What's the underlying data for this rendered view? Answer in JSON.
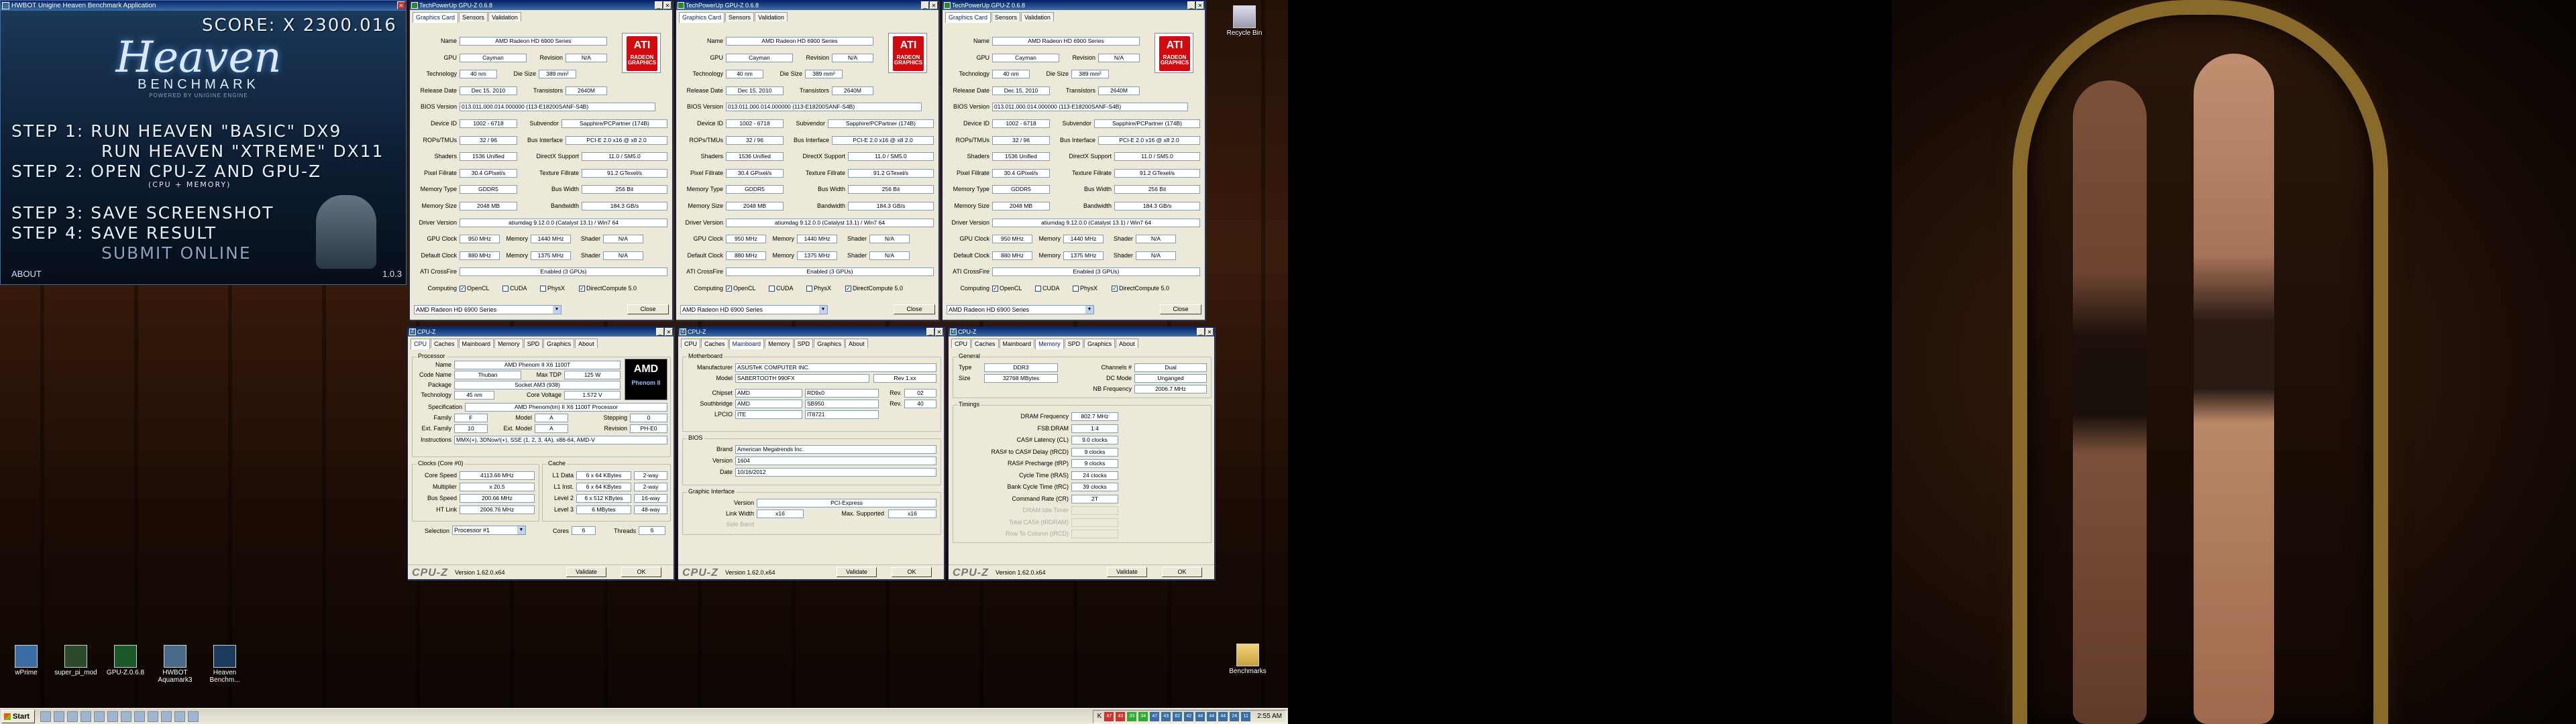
{
  "heaven": {
    "window_title": "HWBOT Unigine Heaven Benchmark Application",
    "score": "SCORE: X 2300.016",
    "logo": "Heaven",
    "logo_sub": "BENCHMARK",
    "logo_powered": "POWERED BY UNIGINE ENGINE",
    "steps": [
      "STEP 1:  RUN HEAVEN \"BASIC\" DX9",
      "RUN HEAVEN \"XTREME\" DX11",
      "STEP 2: OPEN CPU-Z    AND    GPU-Z",
      "(CPU + MEMORY)",
      "STEP 3: SAVE SCREENSHOT",
      "STEP 4: SAVE RESULT",
      "SUBMIT ONLINE"
    ],
    "footer_left": "ABOUT",
    "footer_right": "1.0.3"
  },
  "gpuz": {
    "window_title": "TechPowerUp GPU-Z 0.6.8",
    "tabs": [
      "Graphics Card",
      "Sensors",
      "Validation"
    ],
    "labels": {
      "name": "Name",
      "gpu": "GPU",
      "revision": "Revision",
      "technology": "Technology",
      "die_size": "Die Size",
      "release_date": "Release Date",
      "transistors": "Transistors",
      "bios": "BIOS Version",
      "device_id": "Device ID",
      "subvendor": "Subvendor",
      "rops": "ROPs/TMUs",
      "bus_interface": "Bus Interface",
      "shaders": "Shaders",
      "directx": "DirectX Support",
      "pixel_fillrate": "Pixel Fillrate",
      "texture_fillrate": "Texture Fillrate",
      "memory_type": "Memory Type",
      "bus_width": "Bus Width",
      "memory_size": "Memory Size",
      "bandwidth": "Bandwidth",
      "driver": "Driver Version",
      "gpu_clock": "GPU Clock",
      "memory": "Memory",
      "shader": "Shader",
      "default_clock": "Default Clock",
      "crossfire": "ATI CrossFire",
      "computing": "Computing"
    },
    "values": {
      "name": "AMD Radeon HD 6900 Series",
      "gpu": "Cayman",
      "revision": "N/A",
      "technology": "40 nm",
      "die_size": "389 mm²",
      "release_date": "Dec 15, 2010",
      "transistors": "2640M",
      "bios": "013.011.000.014.000000 (113-E18200SANF-S4B)",
      "device_id": "1002 - 6718",
      "subvendor": "Sapphire/PCPartner (174B)",
      "rops": "32 / 96",
      "bus_interface": "PCI-E 2.0 x16 @ x8 2.0",
      "shaders": "1536 Unified",
      "directx": "11.0 / SM5.0",
      "pixel_fillrate": "30.4 GPixel/s",
      "texture_fillrate": "91.2 GTexel/s",
      "memory_type": "GDDR5",
      "bus_width": "256 Bit",
      "memory_size": "2048 MB",
      "bandwidth": "184.3 GB/s",
      "driver": "atiumdag 9.12.0.0 (Catalyst 13.1) / Win7 64",
      "gpu_clock": "950 MHz",
      "memory_clock": "1440 MHz",
      "shader_clock": "N/A",
      "default_gpu": "880 MHz",
      "default_memory": "1375 MHz",
      "default_shader": "N/A",
      "crossfire": "Enabled (3 GPUs)"
    },
    "computing": [
      "OpenCL",
      "CUDA",
      "PhysX",
      "DirectCompute 5.0"
    ],
    "select": "AMD Radeon HD 6900 Series",
    "close": "Close",
    "ati_logo": "ATI",
    "ati_sub": "RADEON",
    "ati_sub2": "GRAPHICS"
  },
  "cpuz_common": {
    "window_title": "CPU-Z",
    "tabs": [
      "CPU",
      "Caches",
      "Mainboard",
      "Memory",
      "SPD",
      "Graphics",
      "About"
    ],
    "logo": "CPU-Z",
    "version": "Version 1.62.0.x64",
    "validate": "Validate",
    "ok": "OK"
  },
  "cpuz_cpu": {
    "processor": "Processor",
    "rows": {
      "name_l": "Name",
      "name": "AMD Phenom II X6 1100T",
      "code_l": "Code Name",
      "code": "Thuban",
      "tdp_l": "Max TDP",
      "tdp": "125 W",
      "pkg_l": "Package",
      "pkg": "Socket AM3 (938)",
      "tech_l": "Technology",
      "tech": "45 nm",
      "cv_l": "Core Voltage",
      "cv": "1.572 V",
      "spec_l": "Specification",
      "spec": "AMD Phenom(tm) II X6 1100T Processor",
      "fam_l": "Family",
      "fam": "F",
      "model_l": "Model",
      "model": "A",
      "step_l": "Stepping",
      "step": "0",
      "efam_l": "Ext. Family",
      "efam": "10",
      "emod_l": "Ext. Model",
      "emod": "A",
      "rev_l": "Revision",
      "rev": "PH-E0",
      "inst_l": "Instructions",
      "inst": "MMX(+), 3DNow!(+), SSE (1, 2, 3, 4A), x86-64, AMD-V"
    },
    "clocks": "Clocks (Core #0)",
    "cache": "Cache",
    "clock_rows": [
      {
        "l": "Core Speed",
        "v": "4113.66 MHz"
      },
      {
        "l": "Multiplier",
        "v": "x 20.5"
      },
      {
        "l": "Bus Speed",
        "v": "200.66 MHz"
      },
      {
        "l": "HT Link",
        "v": "2006.76 MHz"
      }
    ],
    "cache_rows": [
      {
        "l": "L1 Data",
        "v": "6 x 64 KBytes",
        "w": "2-way"
      },
      {
        "l": "L1 Inst.",
        "v": "6 x 64 KBytes",
        "w": "2-way"
      },
      {
        "l": "Level 2",
        "v": "6 x 512 KBytes",
        "w": "16-way"
      },
      {
        "l": "Level 3",
        "v": "6 MBytes",
        "w": "48-way"
      }
    ],
    "selection_l": "Selection",
    "selection": "Processor #1",
    "cores_l": "Cores",
    "cores": "6",
    "threads_l": "Threads",
    "threads": "6",
    "amd_logo": "AMD",
    "amd_sub": "Phenom II"
  },
  "cpuz_mb": {
    "motherboard": "Motherboard",
    "manu_l": "Manufacturer",
    "manu": "ASUSTeK COMPUTER INC.",
    "model_l": "Model",
    "model": "SABERTOOTH 990FX",
    "rev": "Rev 1.xx",
    "chip_l": "Chipset",
    "chip_v": "AMD",
    "chip_m": "RD9x0",
    "chip_rev_l": "Rev.",
    "chip_rev": "02",
    "south_l": "Southbridge",
    "south_v": "AMD",
    "south_m": "SB950",
    "south_rev": "40",
    "lpc_l": "LPCIO",
    "lpc_v": "ITE",
    "lpc_m": "IT8721",
    "bios": "BIOS",
    "brand_l": "Brand",
    "brand": "American Megatrends Inc.",
    "ver_l": "Version",
    "ver": "1604",
    "date_l": "Date",
    "date": "10/16/2012",
    "gi": "Graphic Interface",
    "gver_l": "Version",
    "gver": "PCI-Express",
    "lw_l": "Link Width",
    "lw": "x16",
    "ms_l": "Max. Supported",
    "ms": "x16",
    "sb_l": "Side Band"
  },
  "cpuz_mem": {
    "general": "General",
    "type_l": "Type",
    "type": "DDR3",
    "ch_l": "Channels #",
    "ch": "Dual",
    "size_l": "Size",
    "size": "32768 MBytes",
    "dc_l": "DC Mode",
    "dc": "Unganged",
    "nb_l": "NB Frequency",
    "nb": "2006.7 MHz",
    "timings": "Timings",
    "rows": [
      {
        "l": "DRAM Frequency",
        "v": "802.7 MHz"
      },
      {
        "l": "FSB:DRAM",
        "v": "1:4"
      },
      {
        "l": "CAS# Latency (CL)",
        "v": "9.0 clocks"
      },
      {
        "l": "RAS# to CAS# Delay (tRCD)",
        "v": "9 clocks"
      },
      {
        "l": "RAS# Precharge (tRP)",
        "v": "9 clocks"
      },
      {
        "l": "Cycle Time (tRAS)",
        "v": "24 clocks"
      },
      {
        "l": "Bank Cycle Time (tRC)",
        "v": "39 clocks"
      },
      {
        "l": "Command Rate (CR)",
        "v": "2T"
      },
      {
        "l": "DRAM Idle Timer",
        "v": ""
      },
      {
        "l": "Total CAS# (tRDRAM)",
        "v": ""
      },
      {
        "l": "Row To Column (tRCD)",
        "v": ""
      }
    ]
  },
  "desktop": {
    "recycle": "Recycle Bin",
    "benchmarks": "Benchmarks",
    "icons": [
      "wPrime",
      "super_pi_mod",
      "GPU-Z.0.6.8",
      "HWBOT Aquamark3",
      "Heaven Benchm..."
    ]
  },
  "taskbar": {
    "start": "Start",
    "clock": "2:55 AM",
    "tray_nums": [
      "47",
      "43",
      "33",
      "34",
      "47",
      "43",
      "62",
      "42",
      "44",
      "44",
      "44",
      "24",
      "11"
    ],
    "tray_k": "K"
  }
}
